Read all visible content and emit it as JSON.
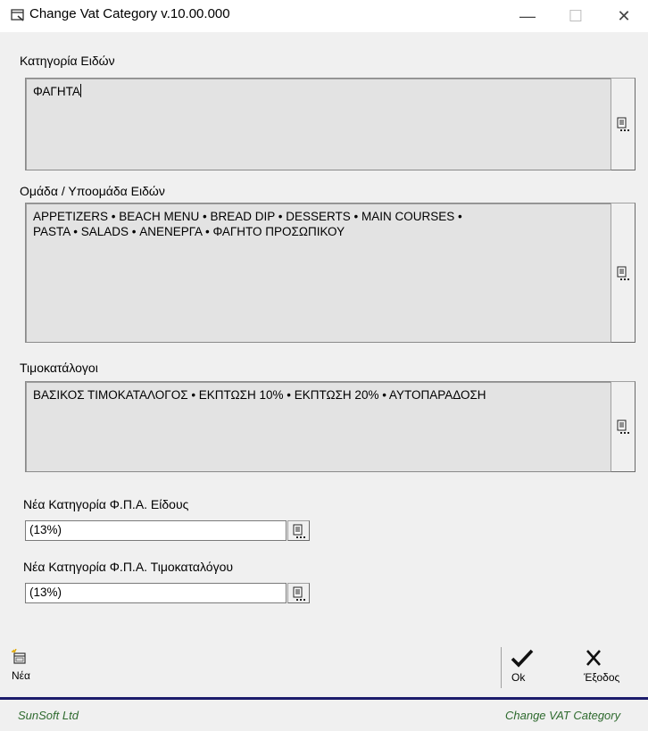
{
  "window": {
    "title": "Change Vat Category v.10.00.000",
    "minimize_glyph": "—",
    "maximize_glyph": "☐",
    "close_glyph": "✕"
  },
  "category": {
    "label": "Κατηγορία Ειδών",
    "value": "ΦΑΓΗΤΑ"
  },
  "group": {
    "label": "Ομάδα / Υποομάδα Ειδών",
    "value": "APPETIZERS • BEACH MENU • BREAD DIP • DESSERTS • MAIN COURSES •\nPASTA • SALADS • ΑΝΕΝΕΡΓΑ • ΦΑΓΗΤΟ ΠΡΟΣΩΠΙΚΟΥ"
  },
  "pricelists": {
    "label": "Τιμοκατάλογοι",
    "value": "ΒΑΣΙΚΟΣ ΤΙΜΟΚΑΤΑΛΟΓΟΣ • ΕΚΠΤΩΣΗ 10% • ΕΚΠΤΩΣΗ 20% • ΑΥΤΟΠΑΡΑΔΟΣΗ"
  },
  "item_vat": {
    "label": "Νέα Κατηγορία Φ.Π.Α. Είδους",
    "value": "(13%)"
  },
  "pricelist_vat": {
    "label": "Νέα Κατηγορία Φ.Π.Α. Τιμοκαταλόγου",
    "value": "(13%)"
  },
  "toolbar": {
    "new_label": "Νέα",
    "ok_label": "Ok",
    "exit_label": "Έξοδος"
  },
  "status": {
    "company": "SunSoft Ltd",
    "app": "Change VAT Category"
  },
  "colors": {
    "status_text": "#2e6a2e",
    "bottom_line": "#1c1c6c"
  },
  "icons": {
    "app": "window-icon",
    "list": "list-icon",
    "new": "new-document-icon",
    "ok": "checkmark-icon",
    "exit": "close-x-icon"
  }
}
